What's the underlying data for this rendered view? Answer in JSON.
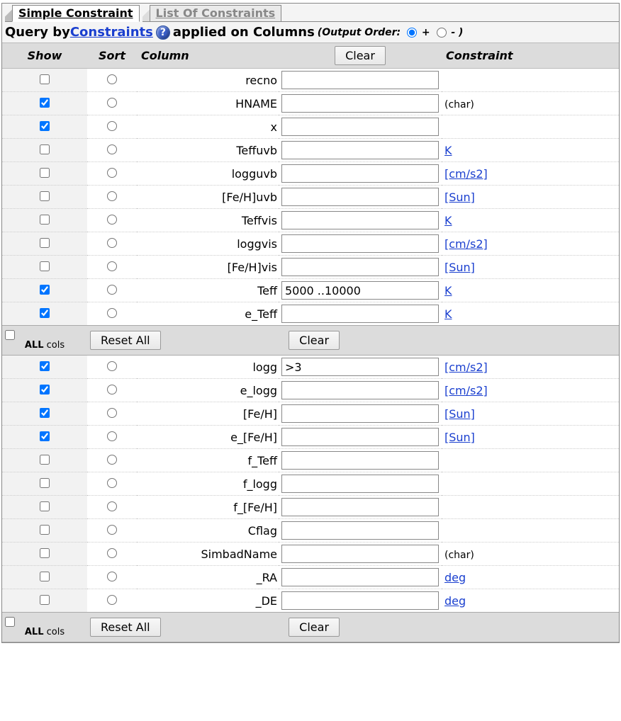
{
  "tabs": {
    "active": "Simple Constraint",
    "inactive": "List Of Constraints"
  },
  "query_line": {
    "prefix": "Query by ",
    "constraints_link": "Constraints ",
    "middle": " applied on Columns ",
    "order_label": "(Output Order: ",
    "plus": " +  ",
    "minus": " - )"
  },
  "headers": {
    "show": "Show",
    "sort": "Sort",
    "column": "Column",
    "clear_btn": "Clear",
    "constraint": "Constraint"
  },
  "buttons": {
    "reset_all": "Reset All",
    "clear": "Clear"
  },
  "all_cols_label": "ALL cols",
  "rows": [
    {
      "show": false,
      "name": "recno",
      "value": "",
      "unit": "",
      "link": false
    },
    {
      "show": true,
      "name": "HNAME",
      "value": "",
      "unit": "(char)",
      "link": false
    },
    {
      "show": true,
      "name": "x",
      "value": "",
      "unit": "",
      "link": false
    },
    {
      "show": false,
      "name": "Teffuvb",
      "value": "",
      "unit": "K",
      "link": true
    },
    {
      "show": false,
      "name": "logguvb",
      "value": "",
      "unit": "[cm/s2]",
      "link": true
    },
    {
      "show": false,
      "name": "[Fe/H]uvb",
      "value": "",
      "unit": "[Sun]",
      "link": true
    },
    {
      "show": false,
      "name": "Teffvis",
      "value": "",
      "unit": "K",
      "link": true
    },
    {
      "show": false,
      "name": "loggvis",
      "value": "",
      "unit": "[cm/s2]",
      "link": true
    },
    {
      "show": false,
      "name": "[Fe/H]vis",
      "value": "",
      "unit": "[Sun]",
      "link": true
    },
    {
      "show": true,
      "name": "Teff",
      "value": "5000 ..10000",
      "unit": "K",
      "link": true
    },
    {
      "show": true,
      "name": "e_Teff",
      "value": "",
      "unit": "K",
      "link": true
    }
  ],
  "rows2": [
    {
      "show": true,
      "name": "logg",
      "value": ">3",
      "unit": "[cm/s2]",
      "link": true
    },
    {
      "show": true,
      "name": "e_logg",
      "value": "",
      "unit": "[cm/s2]",
      "link": true
    },
    {
      "show": true,
      "name": "[Fe/H]",
      "value": "",
      "unit": "[Sun]",
      "link": true
    },
    {
      "show": true,
      "name": "e_[Fe/H]",
      "value": "",
      "unit": "[Sun]",
      "link": true
    },
    {
      "show": false,
      "name": "f_Teff",
      "value": "",
      "unit": "",
      "link": false
    },
    {
      "show": false,
      "name": "f_logg",
      "value": "",
      "unit": "",
      "link": false
    },
    {
      "show": false,
      "name": "f_[Fe/H]",
      "value": "",
      "unit": "",
      "link": false
    },
    {
      "show": false,
      "name": "Cflag",
      "value": "",
      "unit": "",
      "link": false
    },
    {
      "show": false,
      "name": "SimbadName",
      "value": "",
      "unit": "(char)",
      "link": false
    },
    {
      "show": false,
      "name": "_RA",
      "value": "",
      "unit": "deg",
      "link": true
    },
    {
      "show": false,
      "name": "_DE",
      "value": "",
      "unit": "deg",
      "link": true
    }
  ]
}
